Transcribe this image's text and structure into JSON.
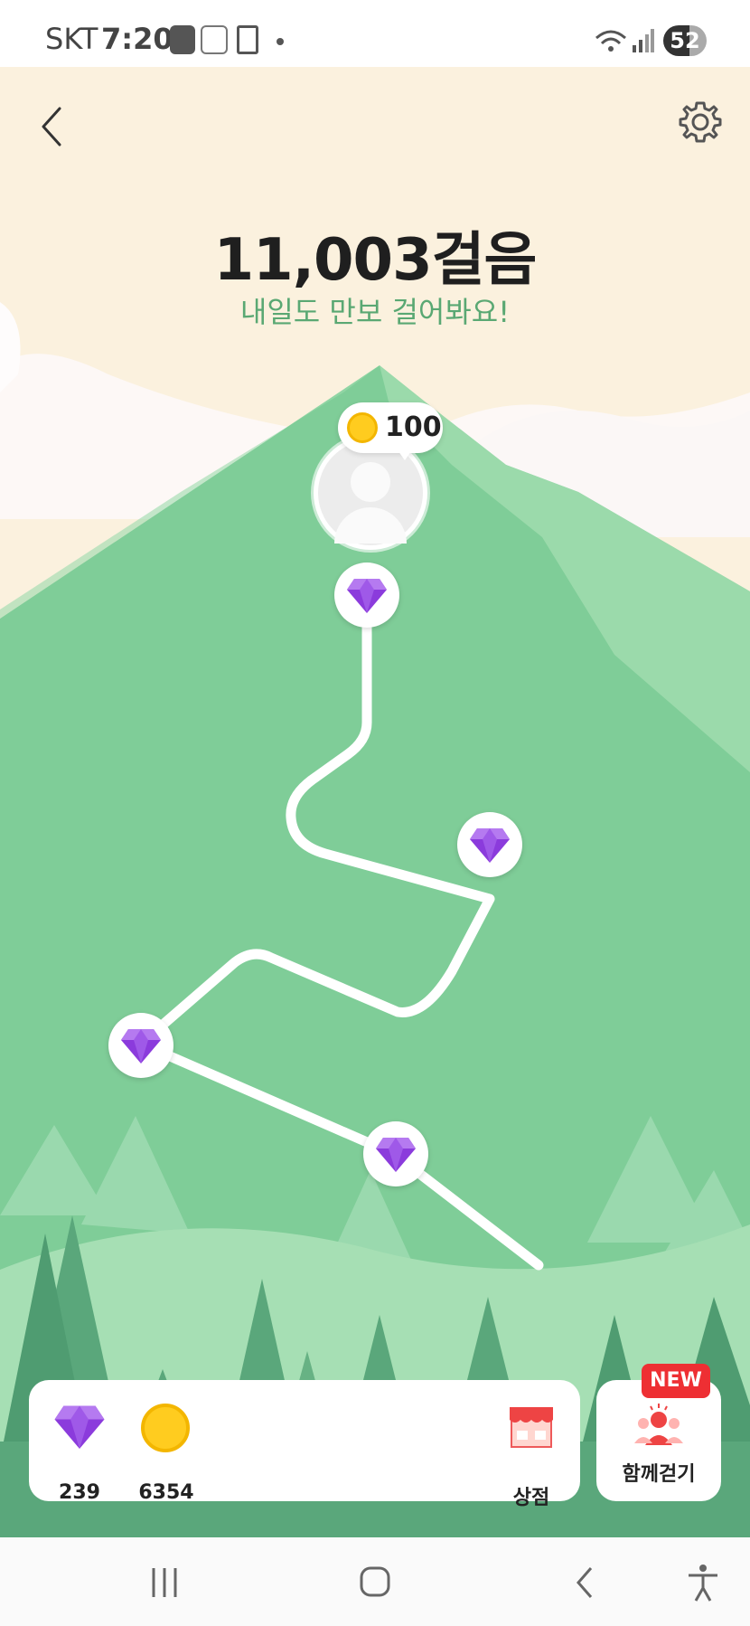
{
  "status_bar": {
    "carrier": "SKT",
    "time": "7:20",
    "battery": "52",
    "icons": [
      "all-one-app-icon",
      "cashfeed-app-icon",
      "screenshot-icon",
      "dot-icon",
      "wifi-5g-icon",
      "signal-icon",
      "battery-icon"
    ]
  },
  "header": {
    "steps": "11,003걸음",
    "subtitle": "내일도 만보 걸어봐요!"
  },
  "profile": {
    "coin_reward": "100"
  },
  "path": {
    "gem_nodes": 4
  },
  "bottom": {
    "gems": "239",
    "coins": "6354",
    "shop_label": "상점",
    "together_label": "함께걷기",
    "new_badge": "NEW"
  },
  "colors": {
    "sky": "#fbf1de",
    "mountain": "#7fcd98",
    "mountain_light": "#a6dfb4",
    "tree_dark": "#5aa77b",
    "accent_green": "#5aa873",
    "gem": "#8b3bdc",
    "coin": "#ffcc1f",
    "new_red": "#ee2f33"
  }
}
